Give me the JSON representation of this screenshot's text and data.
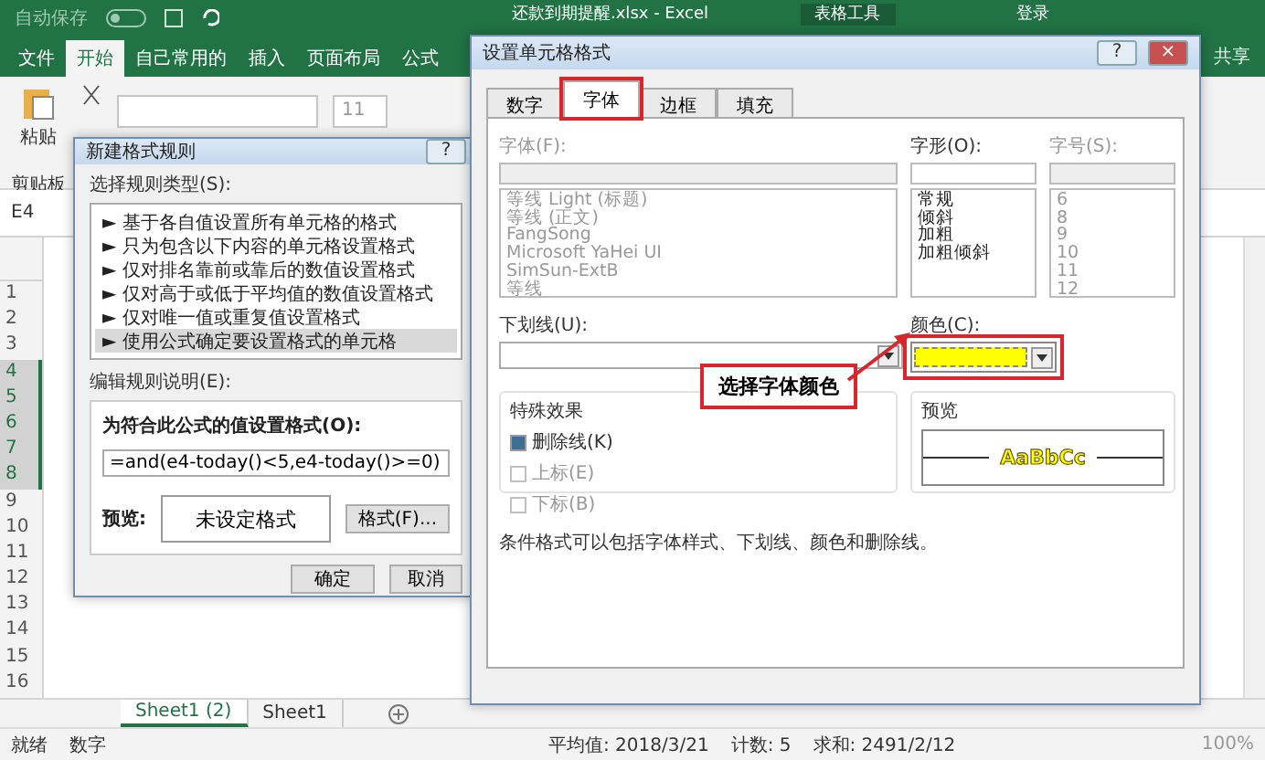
{
  "title_bar": {
    "autosave": "自动保存",
    "title": "还款到期提醒.xlsx - Excel",
    "context_tab": "表格工具",
    "sign_in": "登录"
  },
  "ribbon_tabs": [
    {
      "label": "文件",
      "selected": false
    },
    {
      "label": "开始",
      "selected": true
    },
    {
      "label": "自己常用的",
      "selected": false
    },
    {
      "label": "插入",
      "selected": false
    },
    {
      "label": "页面布局",
      "selected": false
    },
    {
      "label": "公式",
      "selected": false
    }
  ],
  "share": "共享",
  "ribbon": {
    "paste": "粘贴",
    "clipboard": "剪贴板",
    "font_size": "11"
  },
  "name_box": "E4",
  "rows": [
    {
      "label": "1",
      "selected": false
    },
    {
      "label": "2",
      "selected": false
    },
    {
      "label": "3",
      "selected": false
    },
    {
      "label": "4",
      "selected": true
    },
    {
      "label": "5",
      "selected": true
    },
    {
      "label": "6",
      "selected": true
    },
    {
      "label": "7",
      "selected": true
    },
    {
      "label": "8",
      "selected": true
    },
    {
      "label": "9",
      "selected": false
    },
    {
      "label": "10",
      "selected": false
    },
    {
      "label": "11",
      "selected": false
    },
    {
      "label": "12",
      "selected": false
    },
    {
      "label": "13",
      "selected": false
    },
    {
      "label": "14",
      "selected": false
    },
    {
      "label": "15",
      "selected": false
    },
    {
      "label": "16",
      "selected": false
    }
  ],
  "sheet_tabs": [
    {
      "label": "Sheet1 (2)",
      "selected": true
    },
    {
      "label": "Sheet1",
      "selected": false
    }
  ],
  "status_bar": {
    "ready": "就绪",
    "mode": "数字",
    "average": "平均值: 2018/3/21",
    "count": "计数: 5",
    "sum": "求和: 2491/2/12",
    "zoom": "100%"
  },
  "rule_dialog": {
    "title": "新建格式规则",
    "help": "?",
    "type_label": "选择规则类型(S):",
    "rule_types": [
      {
        "marker": "►",
        "label": "基于各自值设置所有单元格的格式",
        "selected": false
      },
      {
        "marker": "►",
        "label": "只为包含以下内容的单元格设置格式",
        "selected": false
      },
      {
        "marker": "►",
        "label": "仅对排名靠前或靠后的数值设置格式",
        "selected": false
      },
      {
        "marker": "►",
        "label": "仅对高于或低于平均值的数值设置格式",
        "selected": false
      },
      {
        "marker": "►",
        "label": "仅对唯一值或重复值设置格式",
        "selected": false
      },
      {
        "marker": "►",
        "label": "使用公式确定要设置格式的单元格",
        "selected": true
      }
    ],
    "edit_label": "编辑规则说明(E):",
    "formula_label": "为符合此公式的值设置格式(O):",
    "formula": "=and(e4-today()<5,e4-today()>=0)",
    "preview_label": "预览:",
    "preview_text": "未设定格式",
    "format_button": "格式(F)...",
    "ok": "确定",
    "cancel": "取消"
  },
  "format_dialog": {
    "title": "设置单元格格式",
    "help": "?",
    "close": "×",
    "tabs": [
      {
        "label": "数字",
        "selected": false
      },
      {
        "label": "字体",
        "selected": true
      },
      {
        "label": "边框",
        "selected": false
      },
      {
        "label": "填充",
        "selected": false
      }
    ],
    "font_label": "字体(F):",
    "fonts": [
      "等线 Light (标题)",
      "等线 (正文)",
      "FangSong",
      "Microsoft YaHei UI",
      "SimSun-ExtB",
      "等线"
    ],
    "style_label": "字形(O):",
    "styles": [
      "常规",
      "倾斜",
      "加粗",
      "加粗倾斜"
    ],
    "size_label": "字号(S):",
    "sizes": [
      "6",
      "8",
      "9",
      "10",
      "11",
      "12"
    ],
    "underline_label": "下划线(U):",
    "color_label": "颜色(C):",
    "color": "#ffff00",
    "effects_label": "特殊效果",
    "effects": [
      {
        "label": "删除线(K)",
        "checked": true,
        "disabled": false
      },
      {
        "label": "上标(E)",
        "checked": false,
        "disabled": true
      },
      {
        "label": "下标(B)",
        "checked": false,
        "disabled": true
      }
    ],
    "preview_label": "预览",
    "preview_text": "AaBbCc",
    "note": "条件格式可以包括字体样式、下划线、颜色和删除线。"
  },
  "callout": "选择字体颜色"
}
